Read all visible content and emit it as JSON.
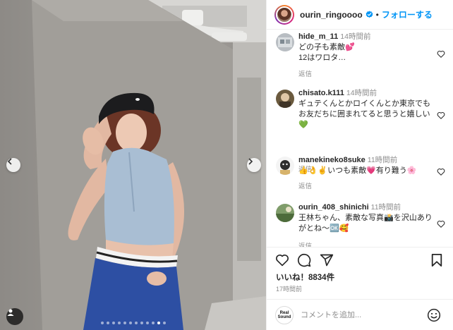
{
  "photo": {
    "slide_count": 12,
    "active_index": 10
  },
  "header": {
    "username": "ourin_ringoooo",
    "separator": "•",
    "follow_label": "フォローする"
  },
  "comments": [
    {
      "user": "hide_m_11",
      "time": "14時間前",
      "text": "どの子も素敵💕\n12はワロタ…",
      "reply": "返信"
    },
    {
      "user": "chisato.k111",
      "time": "14時間前",
      "text": "ギュテくんとかロイくんとか東京でも\nお友だちに囲まれてると思うと嬉しい\n💚",
      "reply": "返信"
    },
    {
      "user": "manekineko8suke",
      "time": "11時間前",
      "text": "👍👌✌️いつも素敵💗有り難う🌸",
      "reply": "返信"
    },
    {
      "user": "ourin_408_shinichi",
      "time": "11時間前",
      "text": "王林ちゃん、素敵な写真📸を沢山あり\nがとね〜🆗🥰",
      "reply": "返信"
    }
  ],
  "stats": {
    "likes": "いいね！8834件",
    "posted": "17時間前"
  },
  "composer": {
    "logo_line1": "Real",
    "logo_line2": "Sound",
    "placeholder": "コメントを追加..."
  },
  "colors": {
    "accent": "#0095f6",
    "muted": "#8e8e8e",
    "text": "#262626",
    "divider": "#efefef"
  },
  "icons": {
    "prev": "chevron-left-icon",
    "next": "chevron-right-icon",
    "user_tag": "user-tag-icon",
    "verified": "verified-badge-icon",
    "heart": "heart-icon",
    "comment": "comment-icon",
    "share": "share-icon",
    "save": "bookmark-icon",
    "emoji": "emoji-icon"
  }
}
